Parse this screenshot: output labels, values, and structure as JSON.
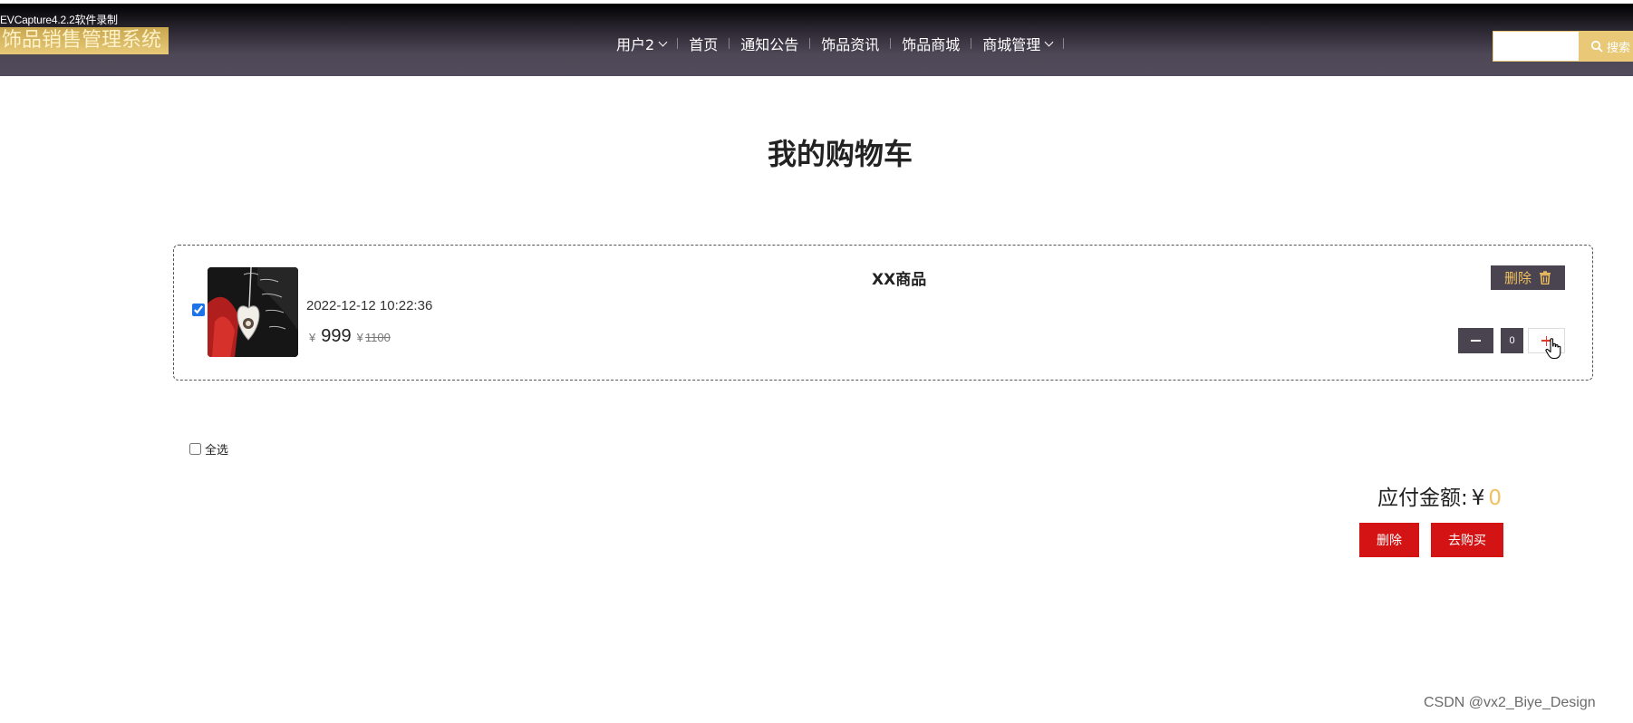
{
  "recording_label": "EVCapture4.2.2软件录制",
  "header": {
    "brand": "饰品销售管理系统",
    "nav": {
      "user": "用户2",
      "home": "首页",
      "notice": "通知公告",
      "news": "饰品资讯",
      "mall": "饰品商城",
      "manage": "商城管理"
    },
    "search_button": "搜索"
  },
  "page": {
    "title": "我的购物车"
  },
  "cart": {
    "items": [
      {
        "name": "XX商品",
        "date": "2022-12-12 10:22:36",
        "currency": "¥",
        "price": "999",
        "original_price": "1100",
        "quantity": "0",
        "checked": true,
        "delete_label": "删除"
      }
    ],
    "select_all_label": "全选",
    "total_label": "应付金额:",
    "total_currency": "¥",
    "total_amount": "0",
    "delete_button": "删除",
    "buy_button": "去购买"
  },
  "watermark": "CSDN @vx2_Biye_Design",
  "colors": {
    "accent_gold": "#f0c15e",
    "nav_dark": "#4a4350",
    "button_red": "#d41414"
  }
}
